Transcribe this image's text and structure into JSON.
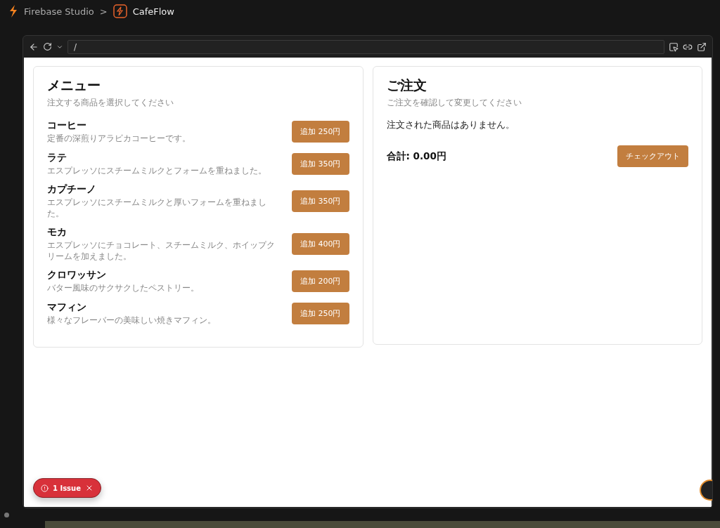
{
  "breadcrumb": {
    "app": "Firebase Studio",
    "separator": ">",
    "project": "CafeFlow"
  },
  "browser": {
    "url": "/"
  },
  "menu": {
    "title": "メニュー",
    "subtitle": "注文する商品を選択してください",
    "items": [
      {
        "name": "コーヒー",
        "description": "定番の深煎りアラビカコーヒーです。",
        "button": "追加 250円"
      },
      {
        "name": "ラテ",
        "description": "エスプレッソにスチームミルクとフォームを重ねました。",
        "button": "追加 350円"
      },
      {
        "name": "カプチーノ",
        "description": "エスプレッソにスチームミルクと厚いフォームを重ねました。",
        "button": "追加 350円"
      },
      {
        "name": "モカ",
        "description": "エスプレッソにチョコレート、スチームミルク、ホイップクリームを加えました。",
        "button": "追加 400円"
      },
      {
        "name": "クロワッサン",
        "description": "バター風味のサクサクしたペストリー。",
        "button": "追加 200円"
      },
      {
        "name": "マフィン",
        "description": "様々なフレーバーの美味しい焼きマフィン。",
        "button": "追加 250円"
      }
    ]
  },
  "order": {
    "title": "ご注文",
    "subtitle": "ご注文を確認して変更してください",
    "empty_message": "注文された商品はありません。",
    "total": "合計: 0.00円",
    "checkout_button": "チェックアウト"
  },
  "issue_badge": {
    "label": "1 Issue"
  }
}
